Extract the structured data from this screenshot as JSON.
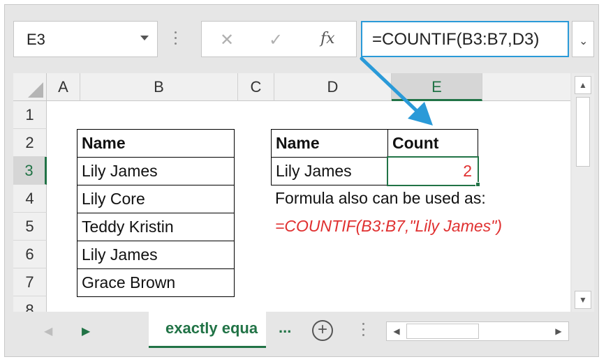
{
  "name_box": {
    "value": "E3"
  },
  "formula_bar": {
    "cancel_icon": "close-icon",
    "enter_icon": "check-icon",
    "fx_label": "fx",
    "formula": "=COUNTIF(B3:B7,D3)"
  },
  "columns": [
    "A",
    "B",
    "C",
    "D",
    "E"
  ],
  "rows": [
    "1",
    "2",
    "3",
    "4",
    "5",
    "6",
    "7",
    "8"
  ],
  "left_table": {
    "header": "Name",
    "items": [
      "Lily James",
      "Lily Core",
      "Teddy Kristin",
      "Lily James",
      "Grace Brown"
    ]
  },
  "right_table": {
    "header_name": "Name",
    "header_count": "Count",
    "name_value": "Lily James",
    "count_value": "2"
  },
  "note": {
    "line1": "Formula also can be used as:",
    "line2": "=COUNTIF(B3:B7,\"Lily James\")"
  },
  "sheet_tabs": {
    "active": "exactly equa",
    "more": "...",
    "add_label": "+"
  },
  "colors": {
    "accent": "#217346",
    "arrow": "#2a9ad8",
    "red": "#e03030"
  }
}
